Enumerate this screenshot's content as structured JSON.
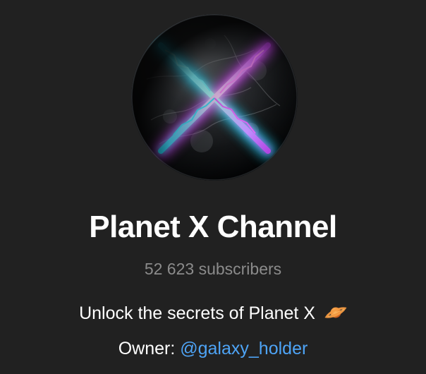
{
  "channel": {
    "avatar_icon": "planet-x-avatar",
    "title": "Planet X Channel",
    "subscribers": "52 623 subscribers",
    "description": "Unlock the secrets of Planet X",
    "description_emoji": "ringed-planet-icon",
    "owner_label": "Owner:",
    "owner_handle": "@galaxy_holder"
  },
  "colors": {
    "background": "#212121",
    "title": "#ffffff",
    "subscribers": "#8b8b8b",
    "link": "#4ea4f6",
    "glow_cyan": "#35d7ff",
    "glow_magenta": "#d64cff"
  }
}
